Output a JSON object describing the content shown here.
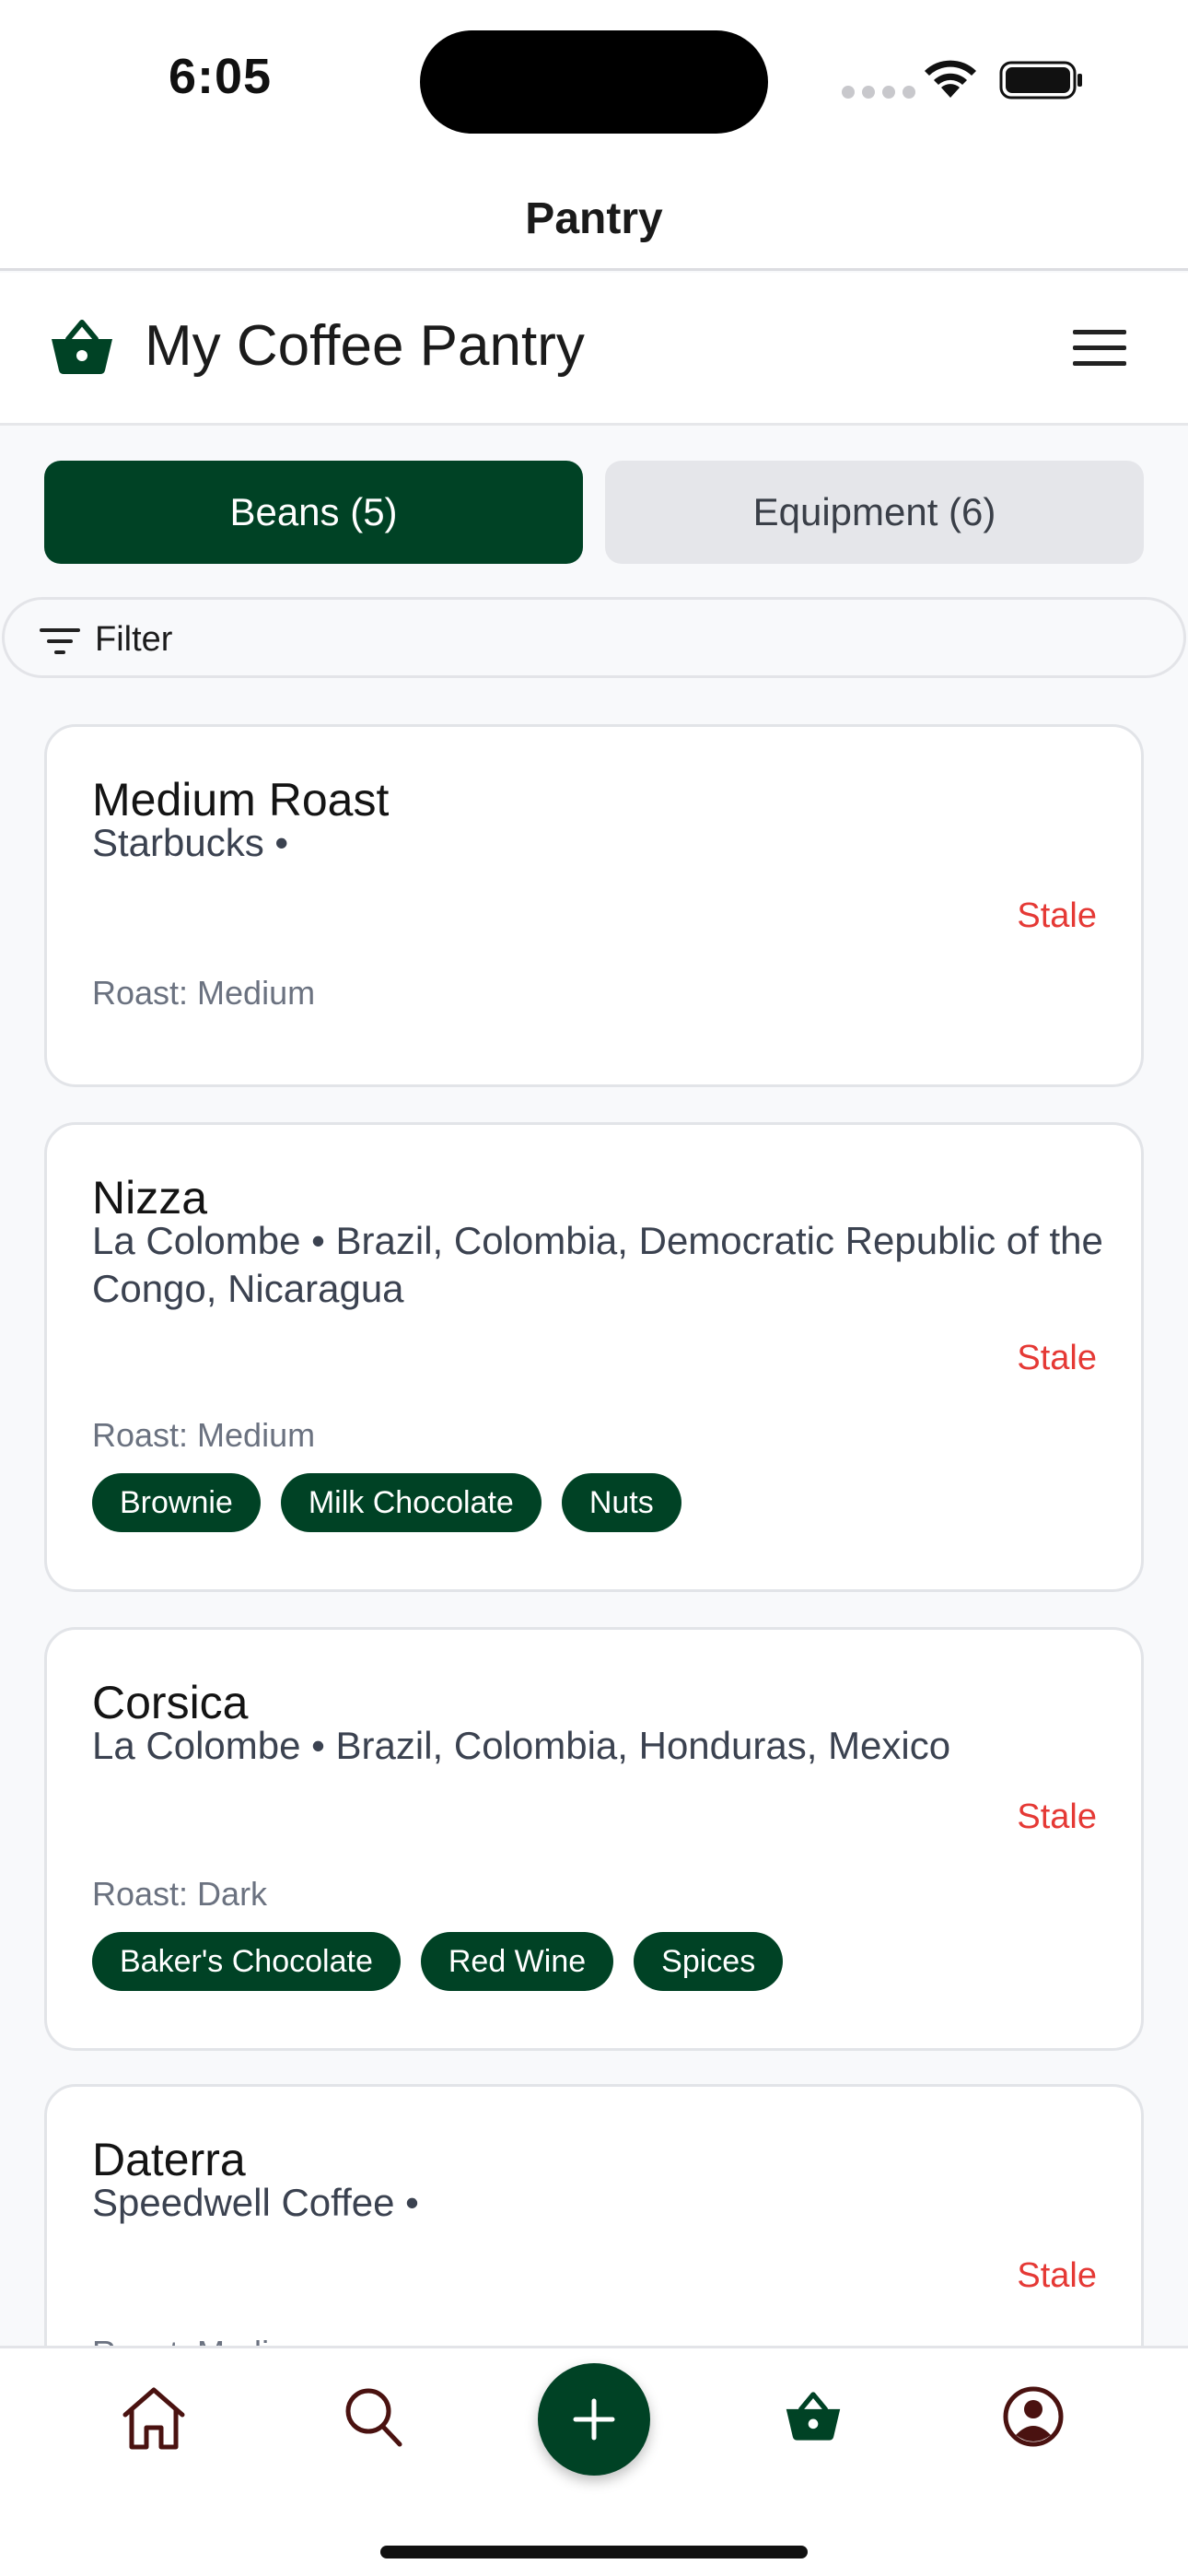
{
  "status_bar": {
    "time": "6:05"
  },
  "nav": {
    "title": "Pantry"
  },
  "header": {
    "title": "My Coffee Pantry"
  },
  "tabs": [
    {
      "label": "Beans (5)",
      "active": true
    },
    {
      "label": "Equipment (6)",
      "active": false
    }
  ],
  "filter": {
    "label": "Filter"
  },
  "beans": [
    {
      "name": "Medium Roast",
      "subtitle": "Starbucks •",
      "status": "Stale",
      "roast": "Roast: Medium",
      "tags": []
    },
    {
      "name": "Nizza",
      "subtitle": "La Colombe • Brazil, Colombia, Democratic Republic of the Congo, Nicaragua",
      "status": "Stale",
      "roast": "Roast: Medium",
      "tags": [
        "Brownie",
        "Milk Chocolate",
        "Nuts"
      ]
    },
    {
      "name": "Corsica",
      "subtitle": "La Colombe • Brazil, Colombia, Honduras, Mexico",
      "status": "Stale",
      "roast": "Roast: Dark",
      "tags": [
        "Baker's Chocolate",
        "Red Wine",
        "Spices"
      ]
    },
    {
      "name": "Daterra",
      "subtitle": "Speedwell Coffee •",
      "status": "Stale",
      "roast": "Roast: Medium",
      "tags": []
    }
  ],
  "bottom_nav": {
    "items": [
      "home-icon",
      "search-icon",
      "add-icon",
      "basket-icon",
      "profile-icon"
    ],
    "active": "basket-icon"
  },
  "colors": {
    "brand": "#004225",
    "stale": "#e53935",
    "nav_icon": "#4a1210"
  }
}
